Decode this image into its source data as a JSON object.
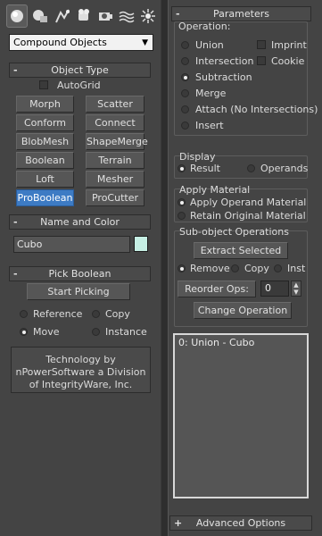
{
  "tabs": [
    {
      "name": "create-tab-icon"
    },
    {
      "name": "modify-tab-icon"
    },
    {
      "name": "hierarchy-tab-icon"
    },
    {
      "name": "motion-tab-icon"
    },
    {
      "name": "display-tab-icon"
    },
    {
      "name": "utilities-tab-icon"
    },
    {
      "name": "particles-tab-icon"
    }
  ],
  "category_dropdown": {
    "value": "Compound Objects"
  },
  "object_type": {
    "title": "Object Type",
    "collapse": "-",
    "autogrid": "AutoGrid",
    "buttons": [
      "Morph",
      "Scatter",
      "Conform",
      "Connect",
      "BlobMesh",
      "ShapeMerge",
      "Boolean",
      "Terrain",
      "Loft",
      "Mesher",
      "ProBoolean",
      "ProCutter"
    ]
  },
  "name_color": {
    "title": "Name and Color",
    "collapse": "-",
    "name": "Cubo",
    "color": "#c6efe4"
  },
  "pick_boolean": {
    "title": "Pick Boolean",
    "collapse": "-",
    "start_picking": "Start Picking",
    "reference": "Reference",
    "copy": "Copy",
    "move": "Move",
    "instance": "Instance",
    "info_line1": "Technology by",
    "info_line2": "nPowerSoftware a Division",
    "info_line3": "of IntegrityWare, Inc."
  },
  "parameters": {
    "title": "Parameters",
    "collapse": "-",
    "operation_label": "Operation:",
    "union": "Union",
    "intersection": "Intersection",
    "subtraction": "Subtraction",
    "merge": "Merge",
    "attach": "Attach (No Intersections)",
    "insert": "Insert",
    "imprint": "Imprint",
    "cookie": "Cookie",
    "display_label": "Display",
    "result": "Result",
    "operands": "Operands",
    "apply_material_label": "Apply Material",
    "apply_operand": "Apply Operand Material",
    "retain_original": "Retain Original Material",
    "subobject_label": "Sub-object Operations",
    "extract_selected": "Extract Selected",
    "remove": "Remove",
    "copy": "Copy",
    "inst": "Inst",
    "reorder_ops": "Reorder Ops:",
    "reorder_value": "0",
    "change_operation": "Change Operation",
    "list_items": [
      "0: Union - Cubo"
    ]
  },
  "advanced": {
    "title": "Advanced Options",
    "collapse": "+"
  }
}
